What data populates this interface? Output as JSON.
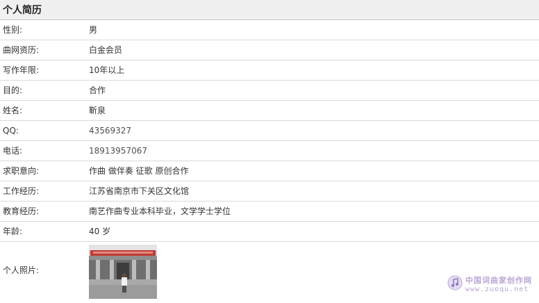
{
  "header": {
    "title": "个人简历"
  },
  "rows": [
    {
      "label": "性别:",
      "value": "男"
    },
    {
      "label": "曲网资历:",
      "value": "白金会员"
    },
    {
      "label": "写作年限:",
      "value": "10年以上"
    },
    {
      "label": "目的:",
      "value": "合作"
    },
    {
      "label": "姓名:",
      "value": "靳泉"
    },
    {
      "label": "QQ:",
      "value": "43569327"
    },
    {
      "label": "电话:",
      "value": "18913957067"
    },
    {
      "label": "求职意向:",
      "value": "作曲 做伴奏 征歌 原创合作"
    },
    {
      "label": "工作经历:",
      "value": "江苏省南京市下关区文化馆"
    },
    {
      "label": "教育经历:",
      "value": "南艺作曲专业本科毕业，文学学士学位"
    },
    {
      "label": "年龄:",
      "value": "40 岁"
    }
  ],
  "photo": {
    "label": "个人照片:"
  },
  "watermark": {
    "top": "中国词曲家创作网",
    "bottom": "www.zuoqu.net"
  }
}
